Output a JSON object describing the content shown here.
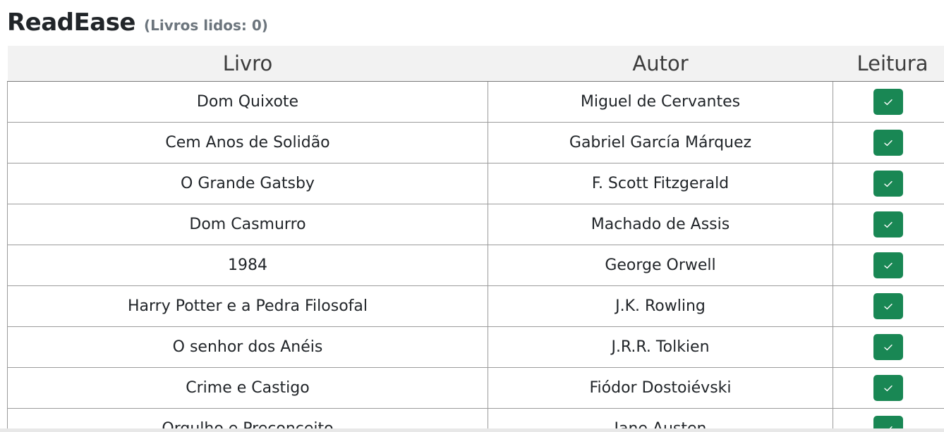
{
  "app": {
    "title": "ReadEase",
    "read_count_label": "(Livros lidos: 0)"
  },
  "table": {
    "headers": {
      "book": "Livro",
      "author": "Autor",
      "reading": "Leitura"
    },
    "rows": [
      {
        "book": "Dom Quixote",
        "author": "Miguel de Cervantes",
        "icon": "check-icon"
      },
      {
        "book": "Cem Anos de Solidão",
        "author": "Gabriel García Márquez",
        "icon": "check-icon"
      },
      {
        "book": "O Grande Gatsby",
        "author": "F. Scott Fitzgerald",
        "icon": "check-icon"
      },
      {
        "book": "Dom Casmurro",
        "author": "Machado de Assis",
        "icon": "check-icon"
      },
      {
        "book": "1984",
        "author": "George Orwell",
        "icon": "check-icon"
      },
      {
        "book": "Harry Potter e a Pedra Filosofal",
        "author": "J.K. Rowling",
        "icon": "check-icon"
      },
      {
        "book": "O senhor dos Anéis",
        "author": "J.R.R. Tolkien",
        "icon": "check-icon"
      },
      {
        "book": "Crime e Castigo",
        "author": "Fiódor Dostoiévski",
        "icon": "check-icon"
      },
      {
        "book": "Orgulho e Preconceito",
        "author": "Jane Austen",
        "icon": "check-icon"
      }
    ]
  },
  "colors": {
    "accent": "#198754",
    "header_bg": "#f2f2f2",
    "muted_text": "#6c757d"
  }
}
